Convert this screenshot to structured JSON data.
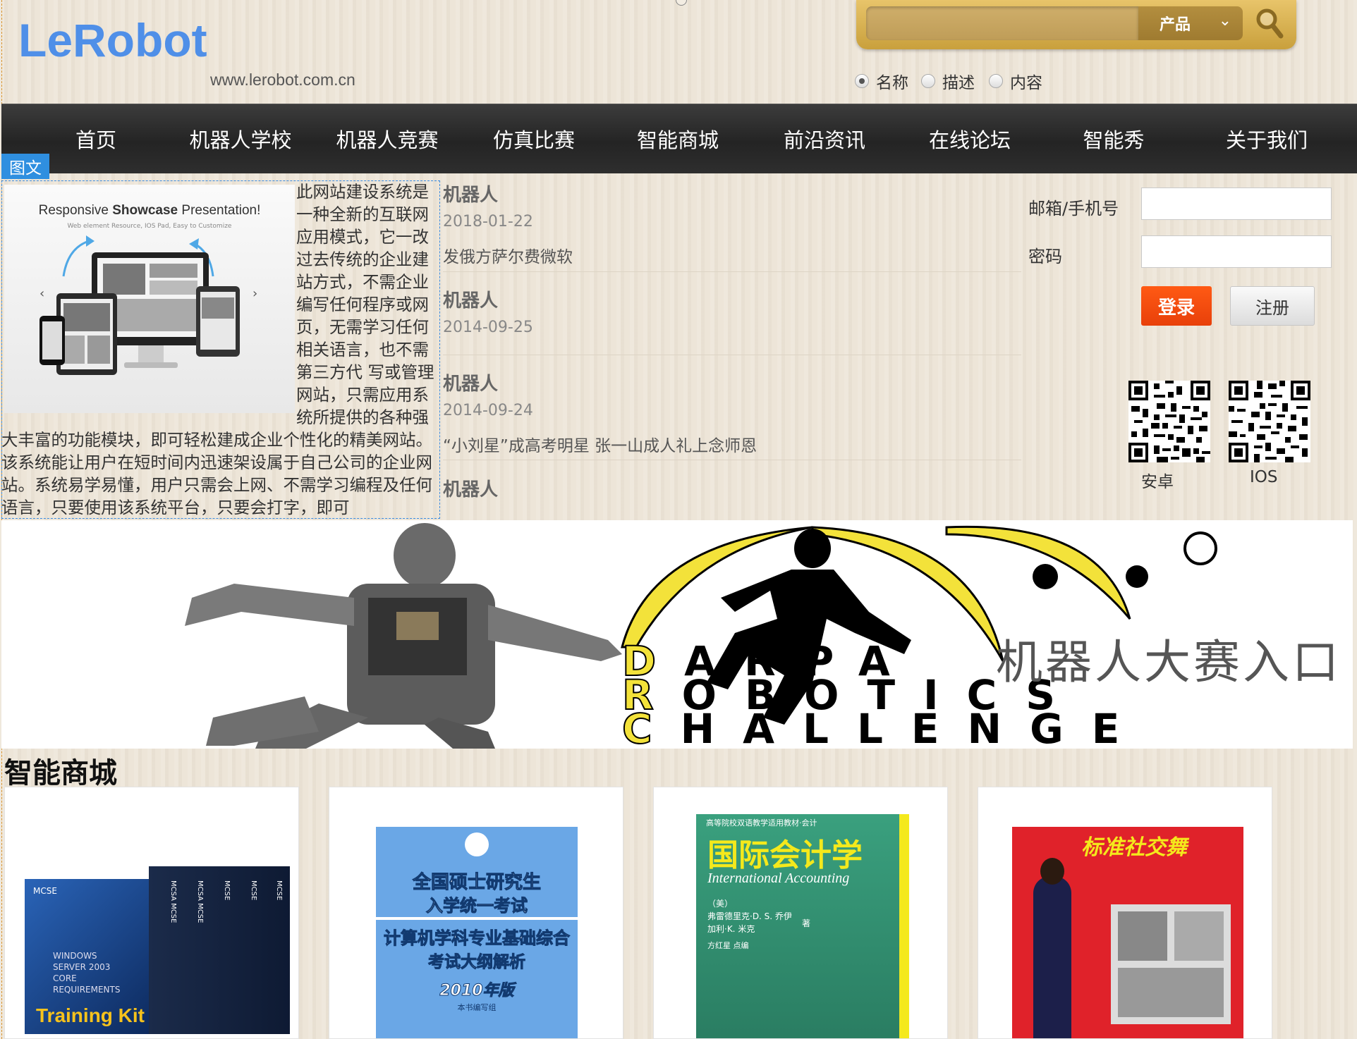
{
  "header": {
    "logo": "LeRobot",
    "domain": "www.lerobot.com.cn"
  },
  "search": {
    "category": "产品",
    "options": [
      "名称",
      "描述",
      "内容"
    ],
    "selected": "名称"
  },
  "nav": {
    "items": [
      "首页",
      "机器人学校",
      "机器人竞赛",
      "仿真比赛",
      "智能商城",
      "前沿资讯",
      "在线论坛",
      "智能秀",
      "关于我们"
    ]
  },
  "tuwen": {
    "tag": "图文",
    "image_title_1": "Responsive ",
    "image_title_2": "Showcase",
    "image_title_3": " Presentation!",
    "image_subtitle": "Web element Resource, IOS Pad, Easy to Customize",
    "body": "此网站建设系统是一种全新的互联网应用模式，它一改过去传统的企业建站方式，不需企业编写任何程序或网页，无需学习任何相关语言，也不需第三方代 写或管理网站，只需应用系统所提供的各种强大丰富的功能模块，即可轻松建成企业个性化的精美网站。该系统能让用户在短时间内迅速架设属于自己公司的企业网 站。系统易学易懂，用户只需会上网、不需学习编程及任何语言，只要使用该系统平台，只要会打字，即可"
  },
  "news": {
    "items": [
      {
        "title": "机器人",
        "date": "2018-01-22",
        "desc": "发俄方萨尔费微软"
      },
      {
        "title": "机器人",
        "date": "2014-09-25",
        "desc": ""
      },
      {
        "title": "机器人",
        "date": "2014-09-24",
        "desc": "“小刘星”成高考明星 张一山成人礼上念师恩"
      },
      {
        "title": "机器人",
        "date": "",
        "desc": ""
      }
    ]
  },
  "login": {
    "email_label": "邮箱/手机号",
    "password_label": "密码",
    "login_button": "登录",
    "register_button": "注册",
    "qr_android": "安卓",
    "qr_ios": "IOS"
  },
  "banner": {
    "text": "机器人大赛入口",
    "logo_line1": "ARPA",
    "logo_line2": "OBOTICS",
    "logo_line3": "HALLENGE",
    "logo_initials": [
      "D",
      "R",
      "C"
    ]
  },
  "shop": {
    "title": "智能商城",
    "products": [
      {
        "cover_lines": [
          "MCSE",
          "WINDOWS",
          "SERVER 2003",
          "CORE",
          "REQUIREMENTS",
          "Training Kit"
        ],
        "spine_labels": [
          "MCSA MCSE",
          "MCSA MCSE",
          "MCSE",
          "MCSE",
          "MCSE"
        ]
      },
      {
        "cover_lines": [
          "全国硕士研究生",
          "入学统一考试",
          "计算机学科专业基础综合",
          "考试大纲解析",
          "2010年版",
          "本书编写组"
        ]
      },
      {
        "cover_lines": [
          "高等院校双语教学适用教材·会计",
          "国际会计学",
          "International Accounting",
          "（美）",
          "弗雷德里克·D. S. 乔伊",
          "加利·K. 米克",
          "著",
          "方红星  点编"
        ]
      },
      {
        "cover_lines": [
          "标准社交舞"
        ]
      }
    ]
  },
  "colors": {
    "accent": "#4f8fe8",
    "nav_bg": "#2a2a2a",
    "login_btn": "#f04a0e",
    "tag_bg": "#2f8fe0"
  }
}
